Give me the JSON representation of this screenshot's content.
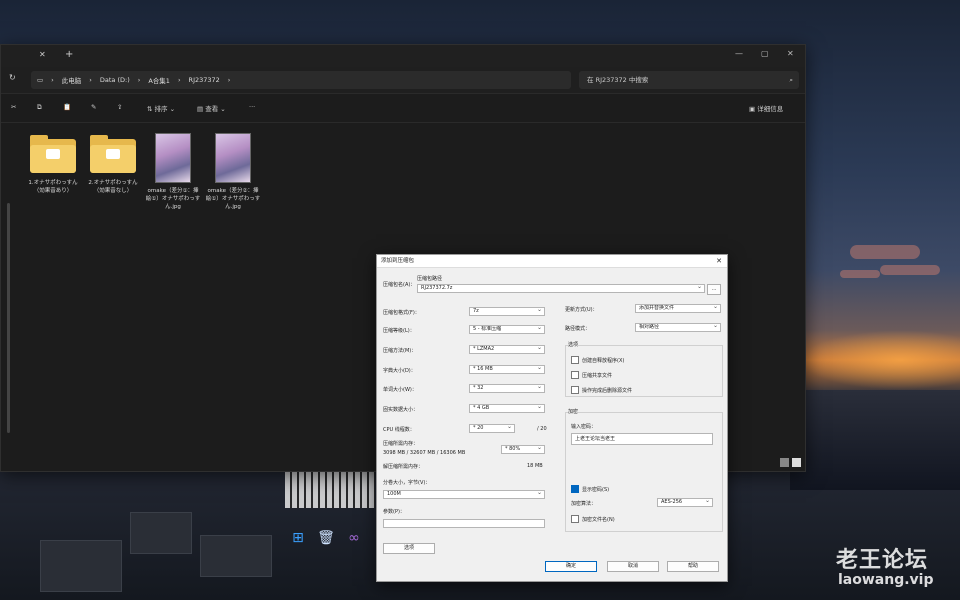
{
  "explorer": {
    "address": {
      "this_pc": "此电脑",
      "drive": "Data (D:)",
      "folder1": "A合集1",
      "folder2": "RJ237372"
    },
    "search_placeholder": "在 RJ237372 中搜索",
    "toolbar": {
      "sort": "排序",
      "view": "查看",
      "more": "···",
      "details": "详细信息"
    },
    "items": [
      {
        "type": "folder",
        "name": "1.オナサポわっすん（効果音あり）"
      },
      {
        "type": "folder",
        "name": "2.オナサポわっすん（効果音なし）"
      },
      {
        "type": "image",
        "name": "omake（差分①：挿絵①）オナサポわっすん.jpg"
      },
      {
        "type": "image",
        "name": "omake（差分②：挿絵①）オナサポわっすん.jpg"
      }
    ]
  },
  "dialog": {
    "title": "添加到压缩包",
    "archive_name_label": "压缩包名(A)：",
    "browse_label": "压缩包路径",
    "archive_name_value": "RJ237372.7z",
    "browse_button": "...",
    "format_label": "压缩包格式(F)：",
    "format_value": "7z",
    "level_label": "压缩等级(L)：",
    "level_value": "5 - 标准压缩",
    "method_label": "压缩方法(M)：",
    "method_value": "* LZMA2",
    "dict_label": "字典大小(D)：",
    "dict_value": "* 16 MB",
    "word_label": "单词大小(W)：",
    "word_value": "* 32",
    "solid_label": "固实数据大小：",
    "solid_value": "* 4 GB",
    "threads_label": "CPU 线程数：",
    "threads_value": "* 20",
    "threads_max": "/ 20",
    "mem_label": "压缩所需内存：",
    "mem_detail": "3098 MB / 32607 MB / 16306 MB",
    "mem_percent": "* 80%",
    "decomp_label": "解压缩所需内存：",
    "decomp_value": "18 MB",
    "split_label": "分卷大小，字节(V)：",
    "split_value": "100M",
    "params_label": "参数(P)：",
    "options_button": "选项",
    "update_label": "更新方式(U)：",
    "update_value": "添加并替换文件",
    "path_label": "路径模式：",
    "path_value": "相对路径",
    "options_group": "选项",
    "opt_sfx": "创建自释放程序(X)",
    "opt_shared": "压缩共享文件",
    "opt_delete": "操作完成后删除源文件",
    "encrypt_group": "加密",
    "password_label": "输入密码：",
    "password_value": "上老王论坛当老王",
    "show_password": "显示密码(S)",
    "enc_method_label": "加密算法：",
    "enc_method_value": "AES-256",
    "enc_names": "加密文件名(N)",
    "ok": "确定",
    "cancel": "取消",
    "help": "帮助"
  },
  "watermark": {
    "cn": "老王论坛",
    "url": "laowang.vip"
  }
}
